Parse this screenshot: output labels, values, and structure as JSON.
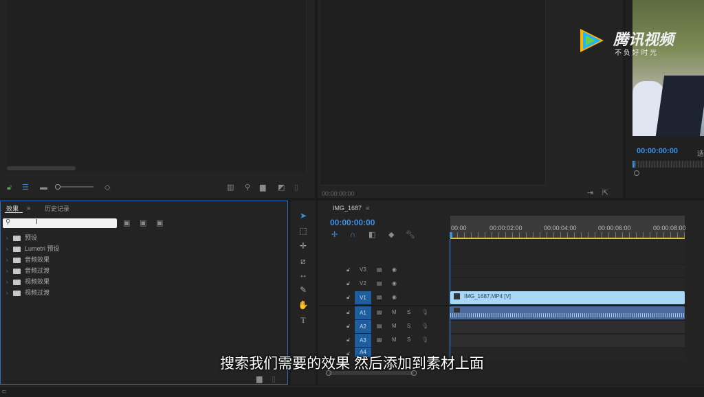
{
  "source_monitor": {
    "scroll_hint": ""
  },
  "program_monitor": {
    "timecode": "00:00:00:00"
  },
  "right_preview": {
    "timecode": "00:00:00:00",
    "side_label": "适"
  },
  "watermark": {
    "brand": "腾讯视频",
    "slogan": "不 负 好 时 光"
  },
  "effects_panel": {
    "tabs": [
      {
        "label": "效果"
      },
      {
        "label": "历史记录"
      }
    ],
    "search_placeholder": "",
    "tree": [
      {
        "label": "预设"
      },
      {
        "label": "Lumetri 预设"
      },
      {
        "label": "音频效果"
      },
      {
        "label": "音频过渡"
      },
      {
        "label": "视频效果"
      },
      {
        "label": "视频过渡"
      }
    ]
  },
  "timeline": {
    "sequence_name": "IMG_1687",
    "timecode": "00:00:00:00",
    "ruler": [
      "00:00",
      "00:00:02:00",
      "00:00:04:00",
      "00:00:06:00",
      "00:00:08:00"
    ],
    "video_tracks": [
      {
        "label": "V3"
      },
      {
        "label": "V2"
      },
      {
        "label": "V1"
      }
    ],
    "audio_tracks": [
      {
        "label": "A1"
      },
      {
        "label": "A2"
      },
      {
        "label": "A3"
      },
      {
        "label": "A4"
      }
    ],
    "mute_label": "M",
    "solo_label": "S",
    "clip_label": "IMG_1687.MP4 [V]"
  },
  "subtitle": "搜索我们需要的效果 然后添加到素材上面",
  "colors": {
    "accent": "#3f8ee0",
    "clip_video": "#a9d8f5",
    "clip_audio": "#4a6a9e",
    "panel_focus": "#2f6fc4"
  }
}
